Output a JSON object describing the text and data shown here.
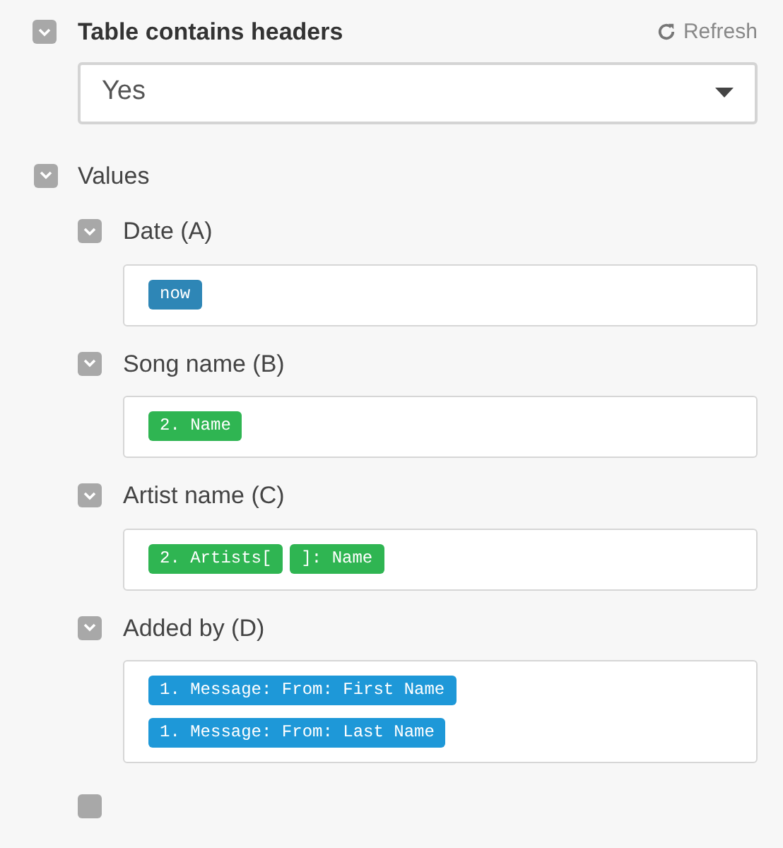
{
  "header": {
    "title": "Table contains headers",
    "expanded": true,
    "refresh": "Refresh",
    "select": {
      "value": "Yes"
    }
  },
  "values": {
    "label": "Values",
    "expanded": true,
    "fields": [
      {
        "label": "Date (A)",
        "expanded": true,
        "tags": [
          {
            "text": "now",
            "color": "#2e86b6"
          }
        ]
      },
      {
        "label": "Song name (B)",
        "expanded": true,
        "tags": [
          {
            "text": "2. Name",
            "color": "#2fb552"
          }
        ]
      },
      {
        "label": "Artist name (C)",
        "expanded": true,
        "tags": [
          {
            "text": "2. Artists[",
            "color": "#2fb552"
          },
          {
            "text": "]: Name",
            "color": "#2fb552"
          }
        ]
      },
      {
        "label": "Added by (D)",
        "expanded": true,
        "tags": [
          {
            "text": "1. Message: From: First Name",
            "color": "#1e98d8"
          },
          {
            "text": "1. Message: From: Last Name",
            "color": "#1e98d8"
          }
        ]
      }
    ]
  }
}
